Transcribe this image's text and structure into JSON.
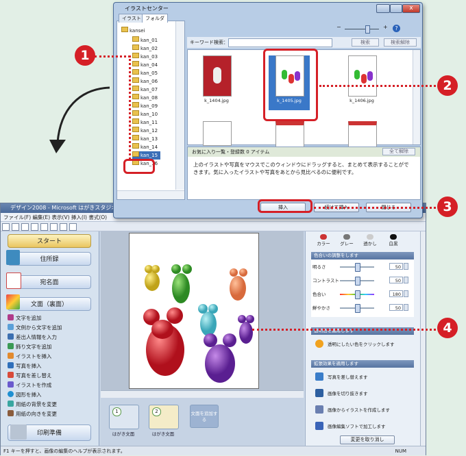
{
  "app": {
    "title": "デザイン2008 - Microsoft はがきスタジオ",
    "menu": "ファイル(F)  編集(E)  表示(V)  挿入(I)  書式(O)",
    "sidebar": {
      "start": "スタート",
      "address_book": "住所録",
      "address_side": "宛名面",
      "back_side": "文面（裏面）",
      "commands": [
        "文字を追加",
        "文例から文字を追加",
        "差出人情報を入力",
        "飾り文字を追加",
        "イラストを挿入",
        "写真を挿入",
        "写真を差し替え",
        "イラストを作成",
        "図形を挿入",
        "用紙の背景を変更",
        "用紙の向きを変更"
      ],
      "print_prep": "印刷準備"
    },
    "thumbs": [
      {
        "num": "1",
        "label": "はがき文面"
      },
      {
        "num": "2",
        "label": "はがき文面"
      }
    ],
    "add_side_label": "文面を追加する",
    "color_modes": [
      "カラー",
      "グレー",
      "透かし",
      "白黒"
    ],
    "adjust_header": "色合いの調整をします",
    "adjust": [
      {
        "label": "明るさ",
        "value": "50",
        "level": 0.5
      },
      {
        "label": "コントラスト",
        "value": "50",
        "level": 0.5
      },
      {
        "label": "色合い",
        "value": "180",
        "level": 0.5
      },
      {
        "label": "鮮やかさ",
        "value": "50",
        "level": 0.5
      }
    ],
    "transparent_header": "透明色を適用します",
    "transparent_text": "透明にしたい色をクリックします",
    "effects_header": "拡張効果を適用します",
    "effects": [
      "写真を差し替えます",
      "画像を切り抜きます",
      "画像からイラストを作成します",
      "画像編集ソフトで加工します"
    ],
    "undo_changes": "変更を取り消し",
    "status_text": "F1 キーを押すと、画像の編集のヘルプが表示されます。",
    "status_num": "NUM"
  },
  "dialog": {
    "title": "イラストセンター",
    "tabs": [
      "イラスト",
      "フォルダ"
    ],
    "tree_root": "kansei",
    "folders": [
      "kan_01",
      "kan_02",
      "kan_03",
      "kan_04",
      "kan_05",
      "kan_06",
      "kan_07",
      "kan_08",
      "kan_09",
      "kan_10",
      "kan_11",
      "kan_12",
      "kan_13",
      "kan_14",
      "kan_15",
      "kan_16"
    ],
    "selected_folder": "kan_15",
    "keyword_label": "キーワード検索：",
    "search_btn": "検索",
    "search_clear_btn": "検索解除",
    "images": [
      "k_1404.jpg",
      "k_1405.jpg",
      "k_1406.jpg"
    ],
    "fav_header": "お気に入り一覧・登録数 0 アイテム",
    "fav_clear": "全て解除",
    "fav_text": "上のイラストや写真をマウスでこのウィンドウにドラッグすると、まとめて表示することができます。気に入ったイラストや写真をあとから見比べるのに便利です。",
    "insert_btn": "挿入",
    "insert_as_btn": "続けて挿入",
    "close_btn": "閉じる"
  },
  "callouts": [
    "1",
    "2",
    "3",
    "4"
  ],
  "accent_color": "#d51f26"
}
